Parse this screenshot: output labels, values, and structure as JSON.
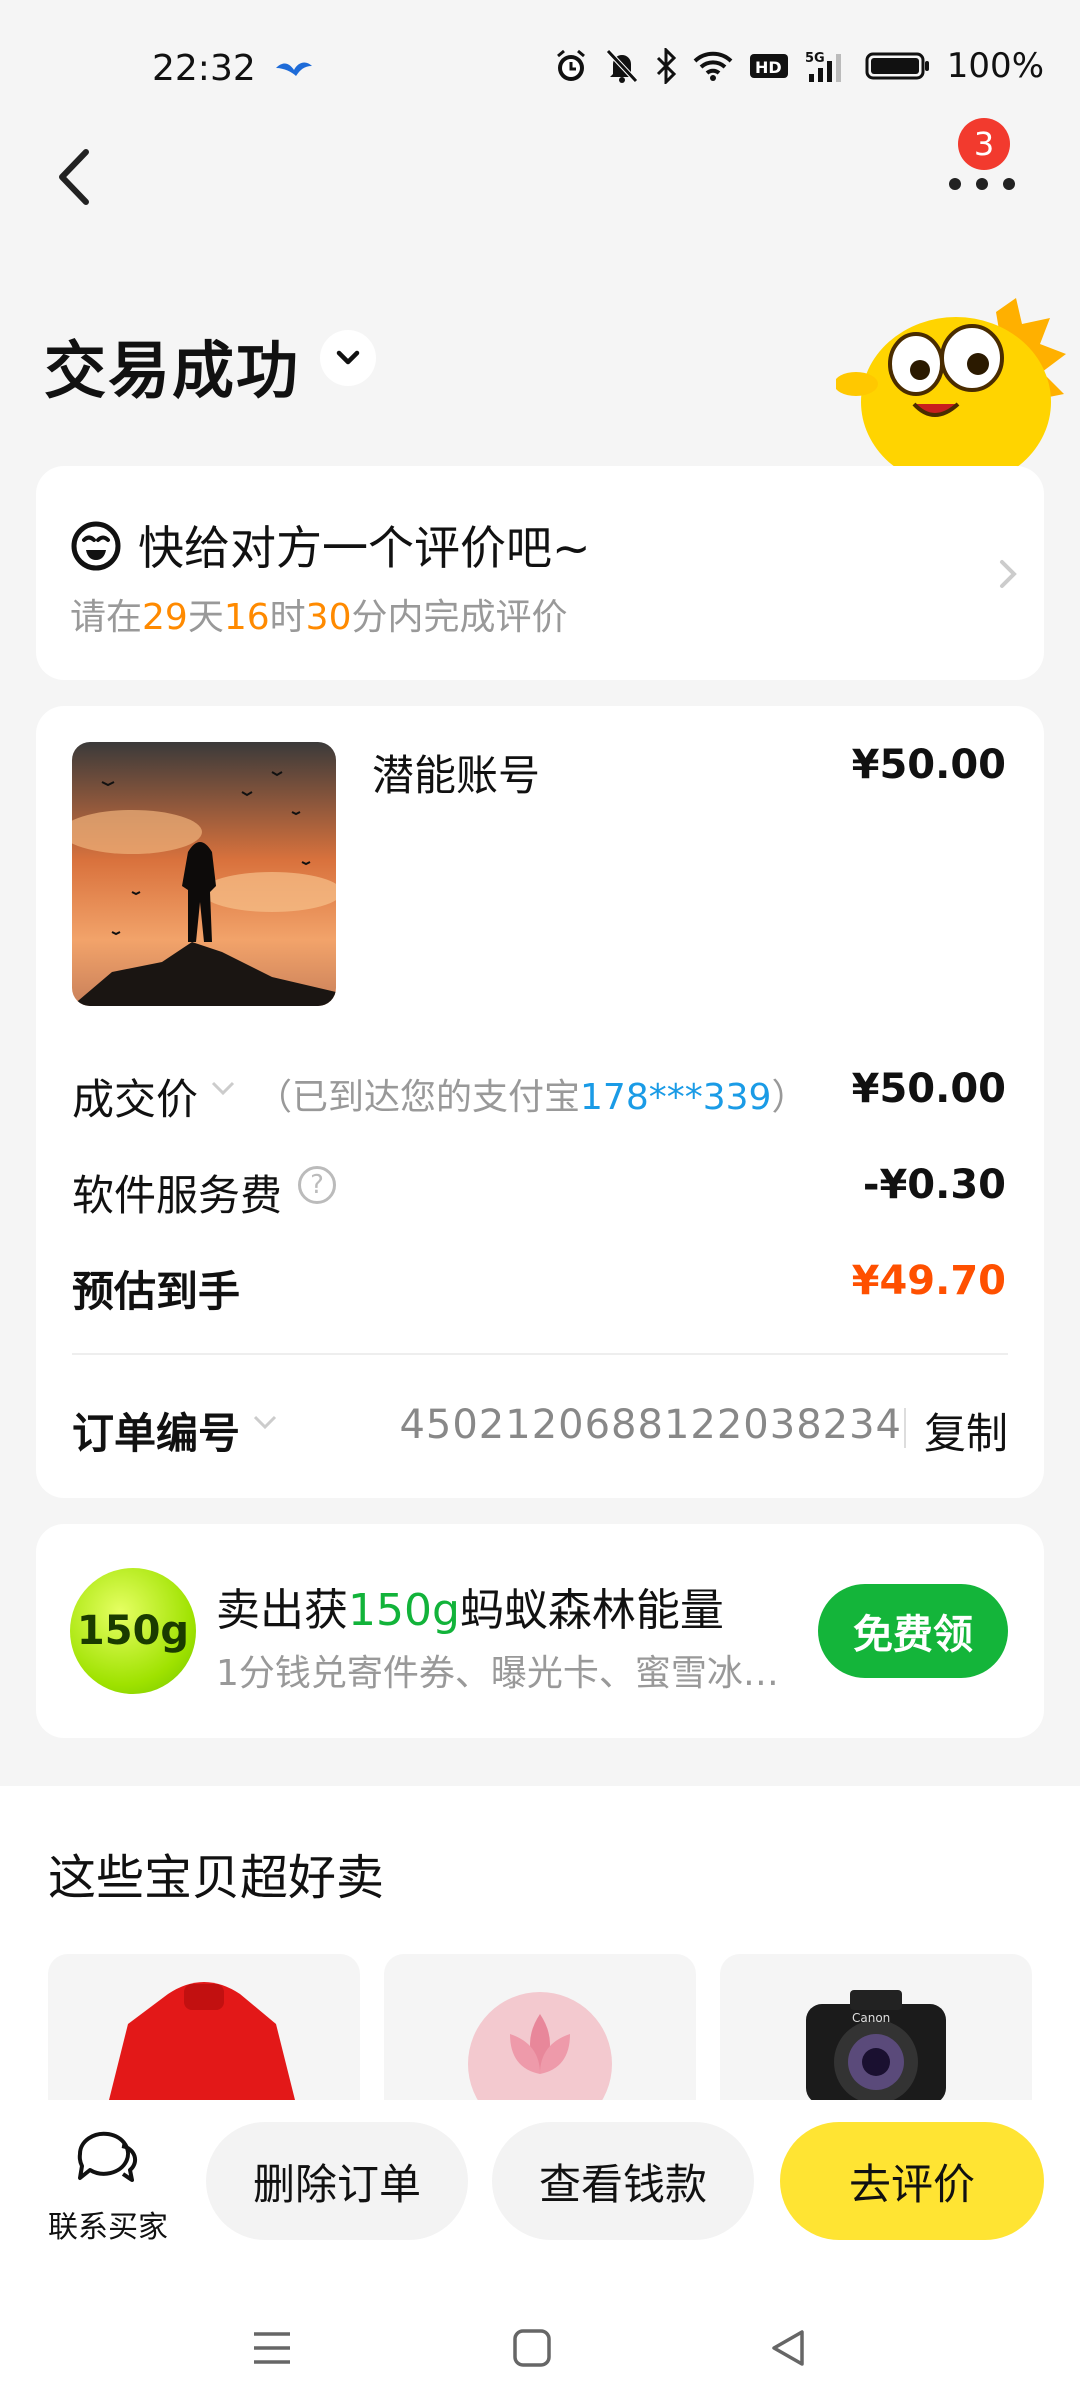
{
  "status_bar": {
    "time": "22:32",
    "battery": "100%",
    "icons": [
      "bird-icon",
      "alarm-icon",
      "bell-off-icon",
      "bluetooth-icon",
      "wifi-icon",
      "hd-icon",
      "signal-5g-icon",
      "battery-icon"
    ]
  },
  "nav": {
    "back_icon": "chevron-left-icon",
    "more_icon": "more-dots-icon",
    "more_badge": "3"
  },
  "header": {
    "title": "交易成功"
  },
  "review_card": {
    "title": "快给对方一个评价吧~",
    "sub_prefix": "请在",
    "days": "29",
    "days_unit": "天",
    "hours": "16",
    "hours_unit": "时",
    "minutes": "30",
    "minutes_suffix": "分内完成评价"
  },
  "order": {
    "product_name": "潜能账号",
    "product_price": "¥50.00",
    "deal_label": "成交价",
    "deal_note_prefix": "（已到达您的支付宝",
    "deal_note_account": "178***339",
    "deal_note_suffix": "）",
    "deal_value": "¥50.00",
    "fee_label": "软件服务费",
    "fee_value": "-¥0.30",
    "estimate_label": "预估到手",
    "estimate_value": "¥49.70",
    "order_no_label": "订单编号",
    "order_no": "4502120688122038234",
    "copy_label": "复制"
  },
  "energy": {
    "badge": "150g",
    "title_prefix": "卖出获",
    "title_amount": "150g",
    "title_suffix": "蚂蚁森林能量",
    "subtitle": "1分钱兑寄件券、曝光卡、蜜雪冰…",
    "button": "免费领"
  },
  "recommend": {
    "title": "这些宝贝超好卖",
    "items": [
      "red-sweater-image",
      "pink-flower-image",
      "camera-image"
    ]
  },
  "bottom": {
    "contact_label": "联系买家",
    "delete_label": "删除订单",
    "view_label": "查看钱款",
    "review_label": "去评价"
  },
  "colors": {
    "accent_yellow": "#ffe433",
    "green": "#14b53a",
    "price_orange": "#ff5000",
    "countdown_orange": "#ff8a00",
    "link_blue": "#1a9be6"
  }
}
